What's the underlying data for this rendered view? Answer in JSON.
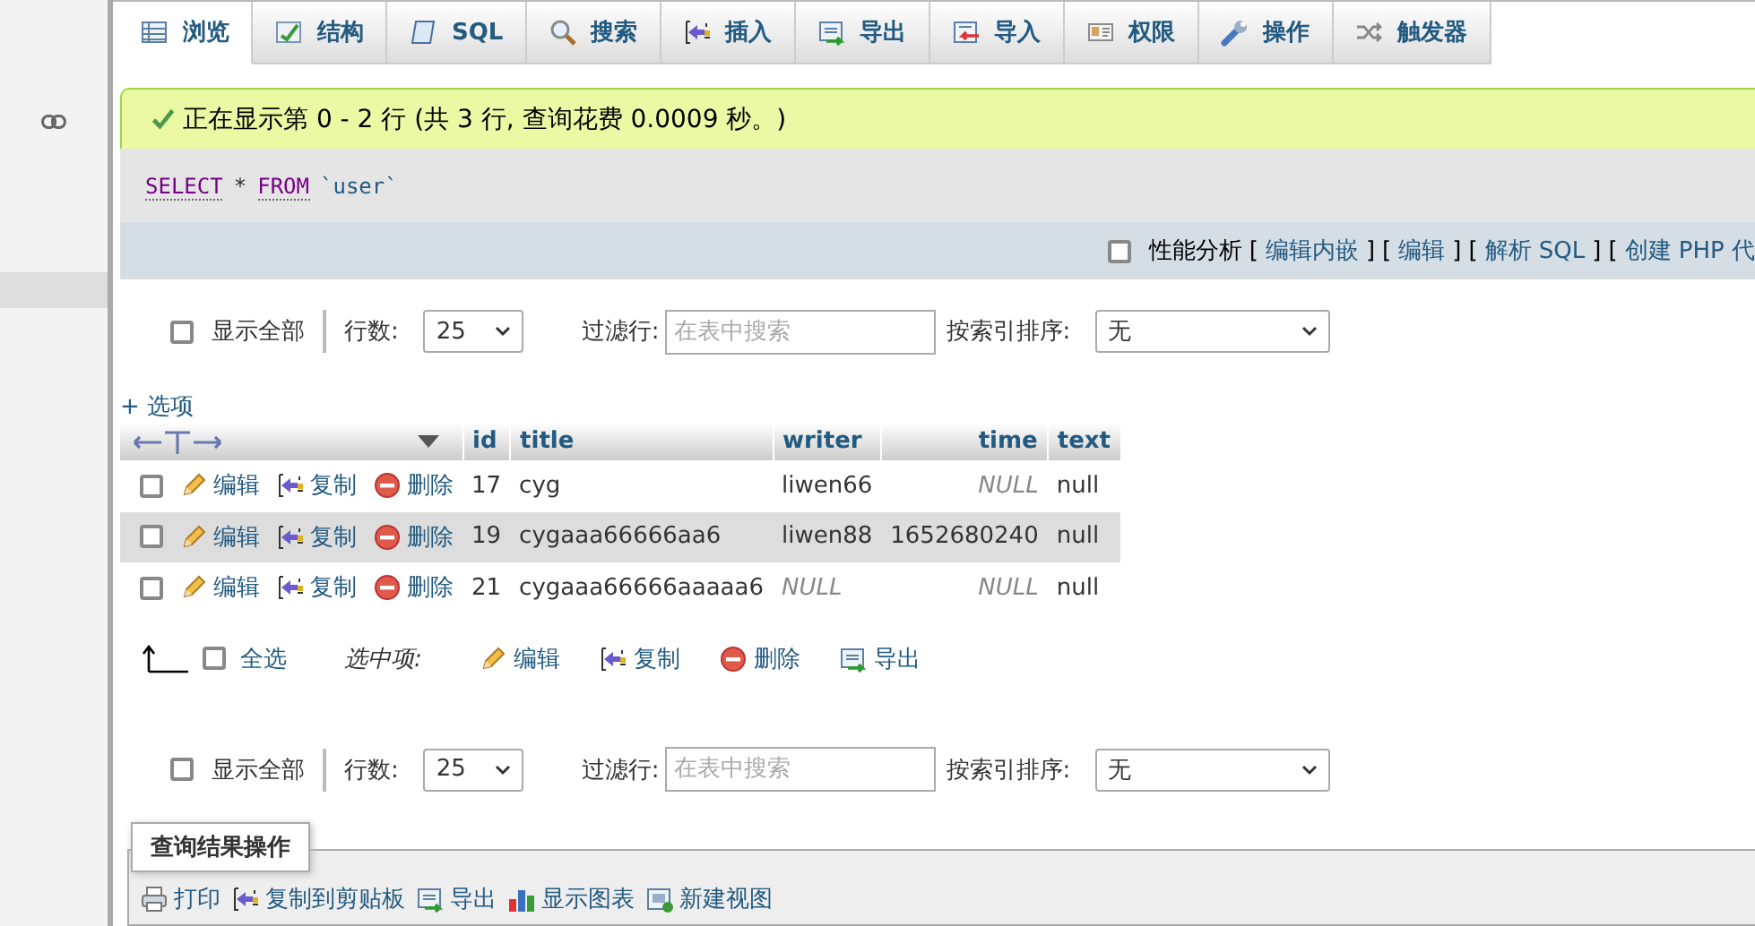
{
  "tabs": [
    {
      "label": "浏览",
      "kind": "browse",
      "selected": true
    },
    {
      "label": "结构",
      "kind": "structure",
      "selected": false
    },
    {
      "label": "SQL",
      "kind": "sql",
      "selected": false
    },
    {
      "label": "搜索",
      "kind": "search",
      "selected": false
    },
    {
      "label": "插入",
      "kind": "insert",
      "selected": false
    },
    {
      "label": "导出",
      "kind": "export",
      "selected": false
    },
    {
      "label": "导入",
      "kind": "import",
      "selected": false
    },
    {
      "label": "权限",
      "kind": "privileges",
      "selected": false
    },
    {
      "label": "操作",
      "kind": "operations",
      "selected": false
    },
    {
      "label": "触发器",
      "kind": "triggers",
      "selected": false
    }
  ],
  "success_message": "正在显示第 0 - 2 行 (共 3 行, 查询花费 0.0009 秒。)",
  "sql": [
    {
      "text": "SELECT",
      "kind": "keyword"
    },
    {
      "text": "*",
      "kind": "operator"
    },
    {
      "text": "FROM",
      "kind": "keyword"
    },
    {
      "text": "`user`",
      "kind": "identifier"
    }
  ],
  "profiling": {
    "label": "性能分析",
    "checked": false,
    "links": [
      {
        "before": "[",
        "text": "编辑内嵌",
        "after": "]"
      },
      {
        "before": "[",
        "text": "编辑",
        "after": "]"
      },
      {
        "before": "[",
        "text": "解析 SQL",
        "after": "]"
      },
      {
        "before": "[",
        "text": "创建 PHP 代"
      }
    ]
  },
  "nav_bars": [
    {
      "show_all": {
        "label": "显示全部",
        "checked": false
      },
      "rows_label": "行数:",
      "rows_value": "25",
      "filter_label": "过滤行:",
      "filter_placeholder": "在表中搜索",
      "sort_label": "按索引排序:",
      "sort_value": "无"
    },
    {
      "show_all": {
        "label": "显示全部",
        "checked": false
      },
      "rows_label": "行数:",
      "rows_value": "25",
      "filter_label": "过滤行:",
      "filter_placeholder": "在表中搜索",
      "sort_label": "按索引排序:",
      "sort_value": "无"
    }
  ],
  "options_link": "+ 选项",
  "table": {
    "columns": [
      "id",
      "title",
      "writer",
      "time",
      "text"
    ],
    "rows": [
      {
        "checked": false,
        "highlighted": false,
        "actions": [
          {
            "label": "编辑",
            "kind": "edit"
          },
          {
            "label": "复制",
            "kind": "copy"
          },
          {
            "label": "删除",
            "kind": "delete"
          }
        ],
        "cells": [
          {
            "text": "17",
            "is_null": false
          },
          {
            "text": "cyg",
            "is_null": false
          },
          {
            "text": "liwen66",
            "is_null": false
          },
          {
            "text": "NULL",
            "is_null": true
          },
          {
            "text": "null",
            "is_null": false
          }
        ]
      },
      {
        "checked": false,
        "highlighted": true,
        "actions": [
          {
            "label": "编辑",
            "kind": "edit"
          },
          {
            "label": "复制",
            "kind": "copy"
          },
          {
            "label": "删除",
            "kind": "delete"
          }
        ],
        "cells": [
          {
            "text": "19",
            "is_null": false
          },
          {
            "text": "cygaaa66666aa6",
            "is_null": false
          },
          {
            "text": "liwen88",
            "is_null": false
          },
          {
            "text": "1652680240",
            "is_null": false
          },
          {
            "text": "null",
            "is_null": false
          }
        ]
      },
      {
        "checked": false,
        "highlighted": false,
        "actions": [
          {
            "label": "编辑",
            "kind": "edit"
          },
          {
            "label": "复制",
            "kind": "copy"
          },
          {
            "label": "删除",
            "kind": "delete"
          }
        ],
        "cells": [
          {
            "text": "21",
            "is_null": false
          },
          {
            "text": "cygaaa66666aaaaa6",
            "is_null": false
          },
          {
            "text": "NULL",
            "is_null": true
          },
          {
            "text": "NULL",
            "is_null": true
          },
          {
            "text": "null",
            "is_null": false
          }
        ]
      }
    ]
  },
  "bulk": {
    "check_all": {
      "label": "全选",
      "checked": false
    },
    "with_selected": "选中项:",
    "actions": [
      {
        "label": "编辑",
        "kind": "edit"
      },
      {
        "label": "复制",
        "kind": "copy"
      },
      {
        "label": "删除",
        "kind": "delete"
      },
      {
        "label": "导出",
        "kind": "export"
      }
    ]
  },
  "query_results_operations": {
    "legend": "查询结果操作",
    "items": [
      {
        "label": "打印",
        "kind": "print"
      },
      {
        "label": "复制到剪贴板",
        "kind": "copy"
      },
      {
        "label": "导出",
        "kind": "export"
      },
      {
        "label": "显示图表",
        "kind": "chart"
      },
      {
        "label": "新建视图",
        "kind": "view"
      }
    ]
  }
}
